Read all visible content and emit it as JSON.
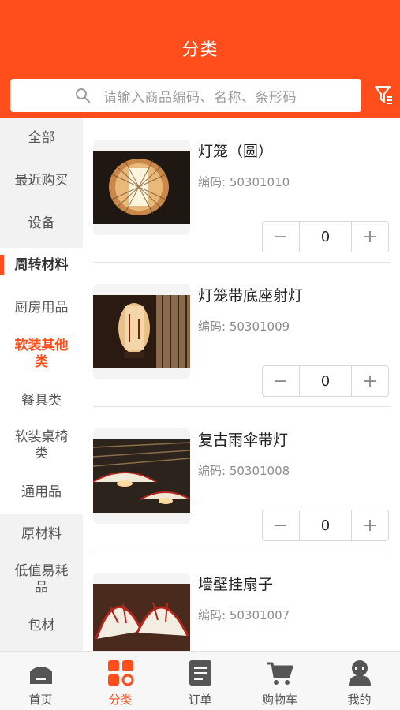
{
  "header": {
    "title": "分类"
  },
  "search": {
    "placeholder": "请输入商品编码、名称、条形码"
  },
  "sidebar": {
    "items": [
      {
        "label": "全部"
      },
      {
        "label": "最近购买"
      },
      {
        "label": "设备"
      },
      {
        "label": "周转材料"
      },
      {
        "label": "厨房用品"
      },
      {
        "label": "软装其他类"
      },
      {
        "label": "餐具类"
      },
      {
        "label": "软装桌椅类"
      },
      {
        "label": "通用品"
      },
      {
        "label": "原材料"
      },
      {
        "label": "低值易耗品"
      },
      {
        "label": "包材"
      }
    ]
  },
  "products": [
    {
      "name": "灯笼（圆）",
      "code": "编码: 50301010",
      "qty": "0"
    },
    {
      "name": "灯笼带底座射灯",
      "code": "编码: 50301009",
      "qty": "0"
    },
    {
      "name": "复古雨伞带灯",
      "code": "编码: 50301008",
      "qty": "0"
    },
    {
      "name": "墙壁挂扇子",
      "code": "编码: 50301007",
      "qty": "0"
    }
  ],
  "stepper": {
    "minus": "−",
    "plus": "+"
  },
  "tabbar": {
    "items": [
      {
        "label": "首页",
        "icon": "home-icon"
      },
      {
        "label": "分类",
        "icon": "category-icon"
      },
      {
        "label": "订单",
        "icon": "order-icon"
      },
      {
        "label": "购物车",
        "icon": "cart-icon"
      },
      {
        "label": "我的",
        "icon": "profile-icon"
      }
    ]
  },
  "colors": {
    "accent": "#ff4e1c",
    "sidebar_bg": "#f2f2f2"
  }
}
